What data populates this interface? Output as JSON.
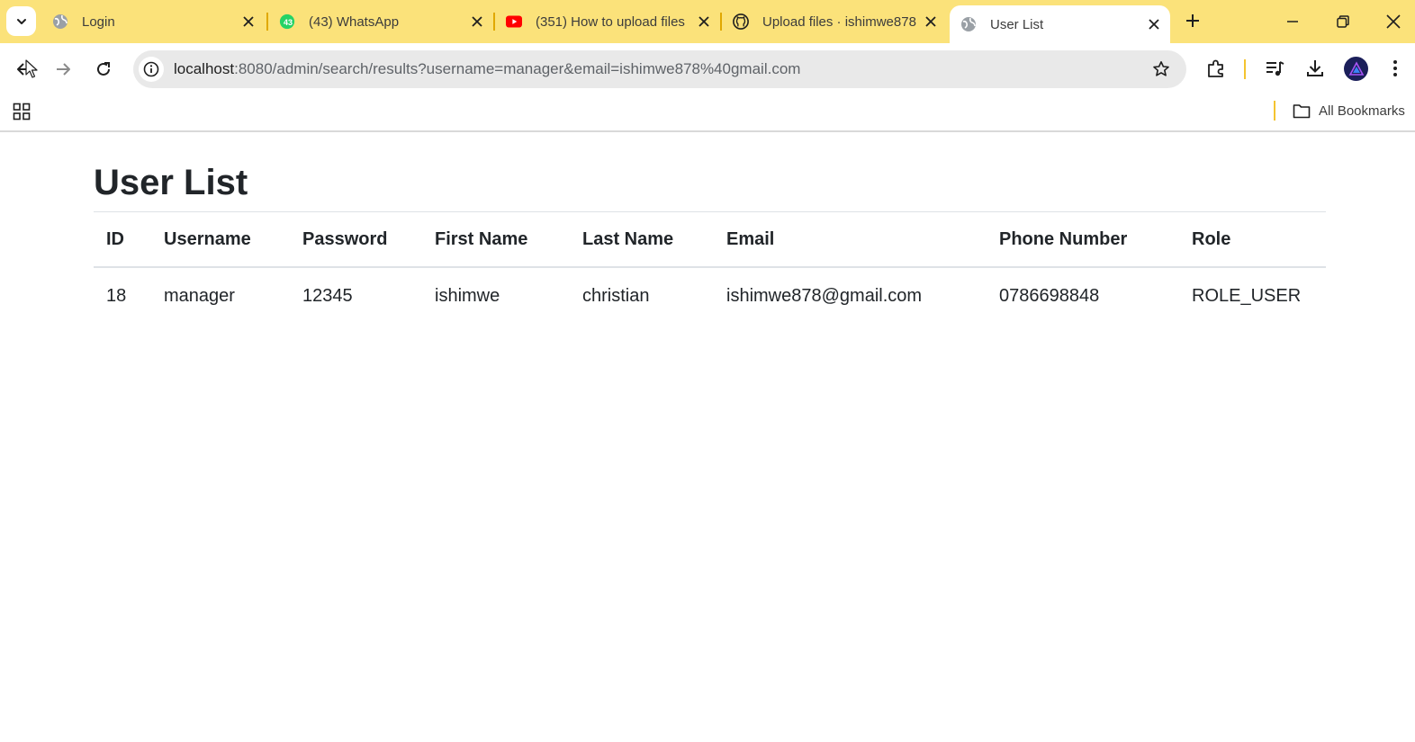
{
  "browser": {
    "tabs": [
      {
        "title": "Login",
        "favicon": "globe-icon"
      },
      {
        "title": "(43) WhatsApp",
        "favicon": "whatsapp-icon"
      },
      {
        "title": "(351) How to upload files",
        "favicon": "youtube-icon"
      },
      {
        "title": "Upload files · ishimwe878",
        "favicon": "github-icon"
      },
      {
        "title": "User List",
        "favicon": "globe-icon",
        "active": true
      }
    ],
    "whatsapp_badge": "43",
    "address": {
      "host": "localhost",
      "rest": ":8080/admin/search/results?username=manager&email=ishimwe878%40gmail.com"
    },
    "bookmarks": {
      "all_label": "All Bookmarks"
    },
    "colors": {
      "tabstrip": "#fbe27a",
      "separator": "#f4c430",
      "omnibox": "#e9e9e9"
    }
  },
  "page": {
    "title": "User List",
    "table": {
      "headers": [
        "ID",
        "Username",
        "Password",
        "First Name",
        "Last Name",
        "Email",
        "Phone Number",
        "Role"
      ],
      "rows": [
        [
          "18",
          "manager",
          "12345",
          "ishimwe",
          "christian",
          "ishimwe878@gmail.com",
          "0786698848",
          "ROLE_USER"
        ]
      ]
    }
  }
}
